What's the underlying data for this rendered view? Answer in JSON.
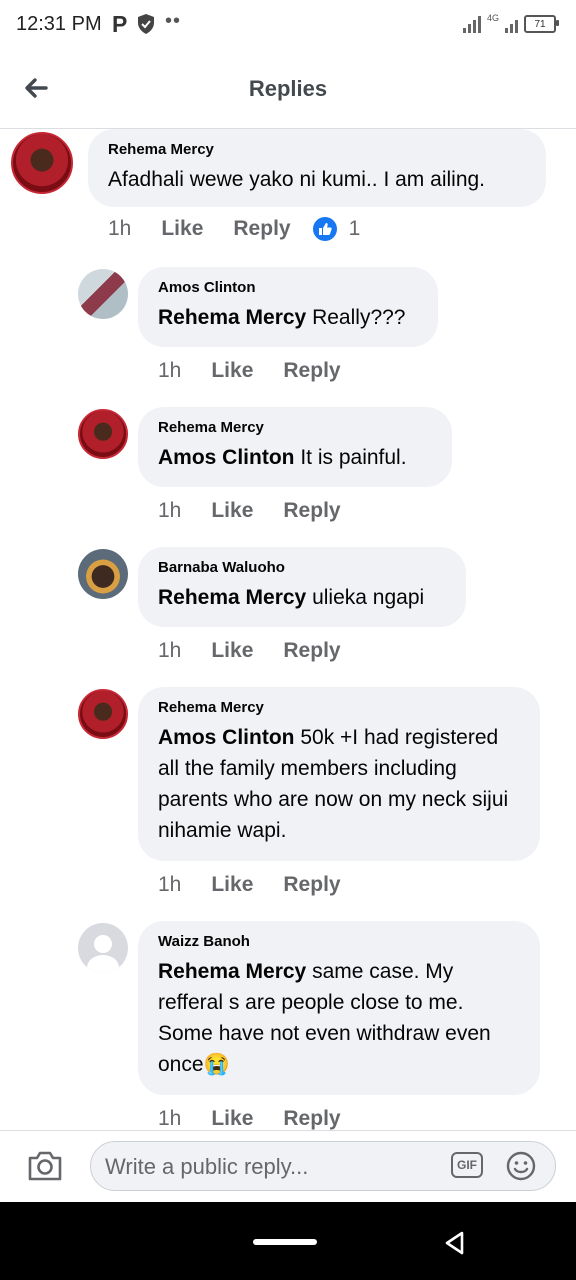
{
  "status_bar": {
    "time": "12:31 PM",
    "app_icon": "P",
    "dots": "••",
    "network": "4G",
    "battery": "71"
  },
  "header": {
    "title": "Replies",
    "back_icon": "arrow-left-icon"
  },
  "comments": [
    {
      "author": "Rehema Mercy",
      "mention": "",
      "text": "Afadhali wewe yako ni kumi.. I am ailing.",
      "time": "1h",
      "like_label": "Like",
      "reply_label": "Reply",
      "reaction_count": "1",
      "avatar": "red-profile"
    },
    {
      "author": "Amos Clinton",
      "mention": "Rehema Mercy",
      "text": " Really???",
      "time": "1h",
      "like_label": "Like",
      "reply_label": "Reply",
      "avatar": "photo"
    },
    {
      "author": "Rehema Mercy",
      "mention": "Amos Clinton",
      "text": " It is painful.",
      "time": "1h",
      "like_label": "Like",
      "reply_label": "Reply",
      "avatar": "red-profile"
    },
    {
      "author": "Barnaba Waluoho",
      "mention": "Rehema Mercy",
      "text": " ulieka ngapi",
      "time": "1h",
      "like_label": "Like",
      "reply_label": "Reply",
      "avatar": "photo"
    },
    {
      "author": "Rehema Mercy",
      "mention": "Amos Clinton",
      "text": " 50k +I had registered all the family members including parents who are now on my neck sijui nihamie wapi.",
      "time": "1h",
      "like_label": "Like",
      "reply_label": "Reply",
      "avatar": "red-profile"
    },
    {
      "author": "Waizz Banoh",
      "mention": "Rehema Mercy",
      "text": " same case. My refferal s are people close to me. Some have not even withdraw even once😭",
      "time": "1h",
      "like_label": "Like",
      "reply_label": "Reply",
      "avatar": "default"
    }
  ],
  "composer": {
    "placeholder": "Write a public reply...",
    "gif_label": "GIF",
    "camera_icon": "camera-icon",
    "emoji_icon": "smiley-icon"
  },
  "colors": {
    "bubble": "#f0f2f5",
    "secondary_text": "#65676b",
    "like_blue": "#1877f2"
  }
}
